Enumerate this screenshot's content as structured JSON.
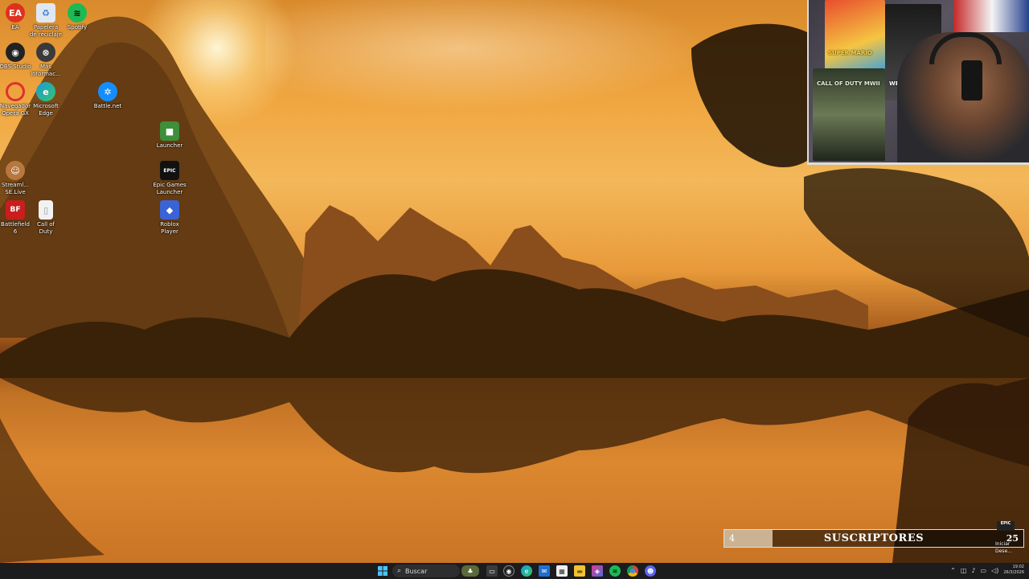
{
  "desktop": {
    "icons": [
      {
        "id": "ea",
        "label": "EA",
        "glyph": "EA",
        "color": "#e0301e",
        "icon_name": "ea-app-icon"
      },
      {
        "id": "recycle",
        "label": "Papelera\nde reciclaje",
        "glyph": "♻",
        "color": "#6aa0d8",
        "icon_name": "recycle-bin-icon"
      },
      {
        "id": "spotify",
        "label": "Spotify",
        "glyph": "≋",
        "color": "#1db954",
        "icon_name": "spotify-icon"
      },
      {
        "id": "obs",
        "label": "OBS Studio",
        "glyph": "◉",
        "color": "#222222",
        "icon_name": "obs-studio-icon"
      },
      {
        "id": "mas",
        "label": "Más\ninformac...",
        "glyph": "⊗",
        "color": "#333333",
        "icon_name": "more-info-icon"
      },
      {
        "id": "opera",
        "label": "Navegador\nOpera GX",
        "glyph": "O",
        "color": "#e03030",
        "icon_name": "opera-gx-icon"
      },
      {
        "id": "edge",
        "label": "Microsoft\nEdge",
        "glyph": "e",
        "color": "#1a9ad9",
        "icon_name": "edge-icon"
      },
      {
        "id": "battlenet",
        "label": "Battle.net",
        "glyph": "✲",
        "color": "#148eff",
        "icon_name": "battlenet-icon"
      },
      {
        "id": "launcher",
        "label": "Launcher",
        "glyph": "■",
        "color": "#3e8e3a",
        "icon_name": "minecraft-launcher-icon"
      },
      {
        "id": "epic",
        "label": "Epic Games\nLauncher",
        "glyph": "EPIC",
        "color": "#111111",
        "icon_name": "epic-games-icon"
      },
      {
        "id": "streamlabs",
        "label": "Streaml...\nSE.Live",
        "glyph": "☺",
        "color": "#b7773e",
        "icon_name": "streamlabs-icon"
      },
      {
        "id": "roblox",
        "label": "Roblox\nPlayer",
        "glyph": "◆",
        "color": "#3a63d6",
        "icon_name": "roblox-icon"
      },
      {
        "id": "bf6",
        "label": "Battlefield\n6",
        "glyph": "BF",
        "color": "#c81e1e",
        "icon_name": "battlefield-icon"
      },
      {
        "id": "cod",
        "label": "Call of\nDuty",
        "glyph": "▯",
        "color": "#f2f2f2",
        "icon_name": "file-icon"
      }
    ]
  },
  "webcam": {
    "posters": [
      "SUPER MARIO",
      "WEDNESDAY",
      "CALL OF DUTY MWII"
    ]
  },
  "subscriber_bar": {
    "current": "4",
    "label": "SUSCRIPTORES",
    "goal": "25",
    "progress": 0.16
  },
  "overlay_notes": {
    "epic_badge": "EPIC",
    "lines": [
      "Iniciar",
      "Dese..."
    ]
  },
  "taskbar": {
    "search_placeholder": "Buscar",
    "clock_time": "19:02",
    "clock_date": "26/3/2026"
  }
}
